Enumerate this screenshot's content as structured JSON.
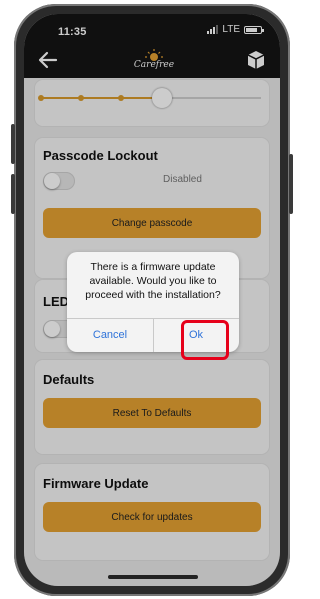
{
  "status_bar": {
    "time": "11:35",
    "network": "LTE"
  },
  "nav": {
    "logo_text": "Carefree"
  },
  "passcode": {
    "title": "Passcode Lockout",
    "toggle_state": "Disabled",
    "button_label": "Change passcode"
  },
  "led": {
    "title": "LED"
  },
  "defaults": {
    "title": "Defaults",
    "button_label": "Reset To Defaults"
  },
  "firmware": {
    "title": "Firmware Update",
    "button_label": "Check for updates"
  },
  "dialog": {
    "message": "There is a firmware update available. Would you like to proceed with the installation?",
    "cancel_label": "Cancel",
    "ok_label": "Ok"
  },
  "slider": {
    "level": 0.55
  },
  "colors": {
    "accent": "#e5a233",
    "highlight": "#e6001a",
    "link": "#2f73d9",
    "header": "#141414"
  }
}
